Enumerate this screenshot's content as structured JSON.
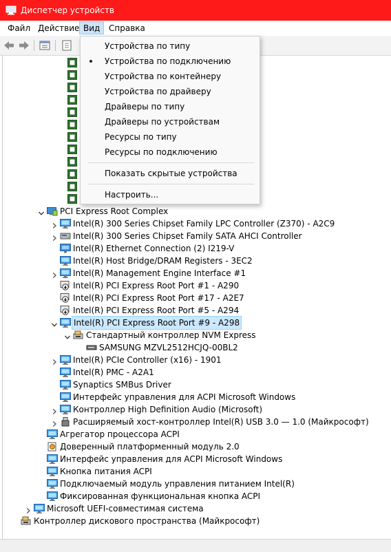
{
  "window": {
    "title": "Диспетчер устройств",
    "accent": "#ff1a1a"
  },
  "menu": {
    "items": [
      "Файл",
      "Действие",
      "Вид",
      "Справка"
    ],
    "active_index": 2
  },
  "toolbar": {
    "buttons": [
      "back-icon",
      "forward-icon",
      "properties-icon",
      "help-icon"
    ]
  },
  "view_menu": {
    "items": [
      {
        "label": "Устройства по типу",
        "checked": false
      },
      {
        "label": "Устройства по подключению",
        "checked": true
      },
      {
        "label": "Устройства по контейнеру",
        "checked": false
      },
      {
        "label": "Устройства по драйверу",
        "checked": false
      },
      {
        "label": "Драйверы по типу",
        "checked": false
      },
      {
        "label": "Драйверы по устройствам",
        "checked": false
      },
      {
        "label": "Ресурсы по типу",
        "checked": false
      },
      {
        "label": "Ресурсы по подключению",
        "checked": false
      },
      {
        "label": "Показать скрытые устройства",
        "checked": false
      },
      {
        "label": "Настроить...",
        "checked": false
      }
    ]
  },
  "tree": {
    "partial_label": "Int",
    "partial_count": 12,
    "rows": [
      {
        "label": "PCI Express Root Complex",
        "level": 2,
        "expander": "expanded",
        "icon": "pci-icon"
      },
      {
        "label": "Intel(R) 300 Series Chipset Family LPC Controller (Z370) - A2C9",
        "level": 3,
        "expander": "collapsed",
        "icon": "monitor-icon"
      },
      {
        "label": "Intel(R) 300 Series Chipset Family SATA AHCI Controller",
        "level": 3,
        "expander": "collapsed",
        "icon": "storage-icon"
      },
      {
        "label": "Intel(R) Ethernet Connection (2) I219-V",
        "level": 3,
        "expander": "none",
        "icon": "network-icon"
      },
      {
        "label": "Intel(R) Host Bridge/DRAM Registers - 3EC2",
        "level": 3,
        "expander": "none",
        "icon": "monitor-icon"
      },
      {
        "label": "Intel(R) Management Engine Interface #1",
        "level": 3,
        "expander": "collapsed",
        "icon": "monitor-icon"
      },
      {
        "label": "Intel(R) PCI Express Root Port #1 - A290",
        "level": 3,
        "expander": "none",
        "icon": "disabled-device-icon"
      },
      {
        "label": "Intel(R) PCI Express Root Port #17 - A2E7",
        "level": 3,
        "expander": "none",
        "icon": "disabled-device-icon"
      },
      {
        "label": "Intel(R) PCI Express Root Port #5 - A294",
        "level": 3,
        "expander": "none",
        "icon": "disabled-device-icon"
      },
      {
        "label": "Intel(R) PCI Express Root Port #9 - A298",
        "level": 3,
        "expander": "expanded",
        "icon": "monitor-icon",
        "selected": true
      },
      {
        "label": "Стандартный контроллер NVM Express",
        "level": 4,
        "expander": "expanded",
        "icon": "storage-controller-icon"
      },
      {
        "label": "SAMSUNG MZVL2512HCJQ-00BL2",
        "level": 5,
        "expander": "none",
        "icon": "disk-icon"
      },
      {
        "label": "Intel(R) PCIe Controller (x16) - 1901",
        "level": 3,
        "expander": "collapsed",
        "icon": "monitor-icon"
      },
      {
        "label": "Intel(R) PMC - A2A1",
        "level": 3,
        "expander": "none",
        "icon": "monitor-icon"
      },
      {
        "label": "Synaptics SMBus Driver",
        "level": 3,
        "expander": "none",
        "icon": "monitor-icon"
      },
      {
        "label": "Интерфейс управления для ACPI Microsoft Windows",
        "level": 3,
        "expander": "none",
        "icon": "monitor-icon"
      },
      {
        "label": "Контроллер High Definition Audio (Microsoft)",
        "level": 3,
        "expander": "collapsed",
        "icon": "monitor-icon"
      },
      {
        "label": "Расширяемый хост-контроллер Intel(R) USB 3.0 — 1.0 (Майкрософт)",
        "level": 3,
        "expander": "collapsed",
        "icon": "usb-icon"
      },
      {
        "label": "Агрегатор процессора ACPI",
        "level": 2,
        "expander": "none",
        "icon": "monitor-icon"
      },
      {
        "label": "Доверенный платформенный модуль 2.0",
        "level": 2,
        "expander": "none",
        "icon": "security-chip-icon"
      },
      {
        "label": "Интерфейс управления для ACPI Microsoft Windows",
        "level": 2,
        "expander": "none",
        "icon": "monitor-icon"
      },
      {
        "label": "Кнопка питания ACPI",
        "level": 2,
        "expander": "none",
        "icon": "monitor-icon"
      },
      {
        "label": "Подключаемый модуль управления питанием Intel(R)",
        "level": 2,
        "expander": "none",
        "icon": "monitor-icon"
      },
      {
        "label": "Фиксированная функциональная кнопка ACPI",
        "level": 2,
        "expander": "none",
        "icon": "monitor-icon"
      },
      {
        "label": "Microsoft UEFI-совместимая система",
        "level": 1,
        "expander": "collapsed",
        "icon": "monitor-icon"
      },
      {
        "label": "Контроллер дискового пространства (Майкрософт)",
        "level": 0,
        "expander": "none",
        "icon": "storage-controller-icon"
      }
    ]
  }
}
